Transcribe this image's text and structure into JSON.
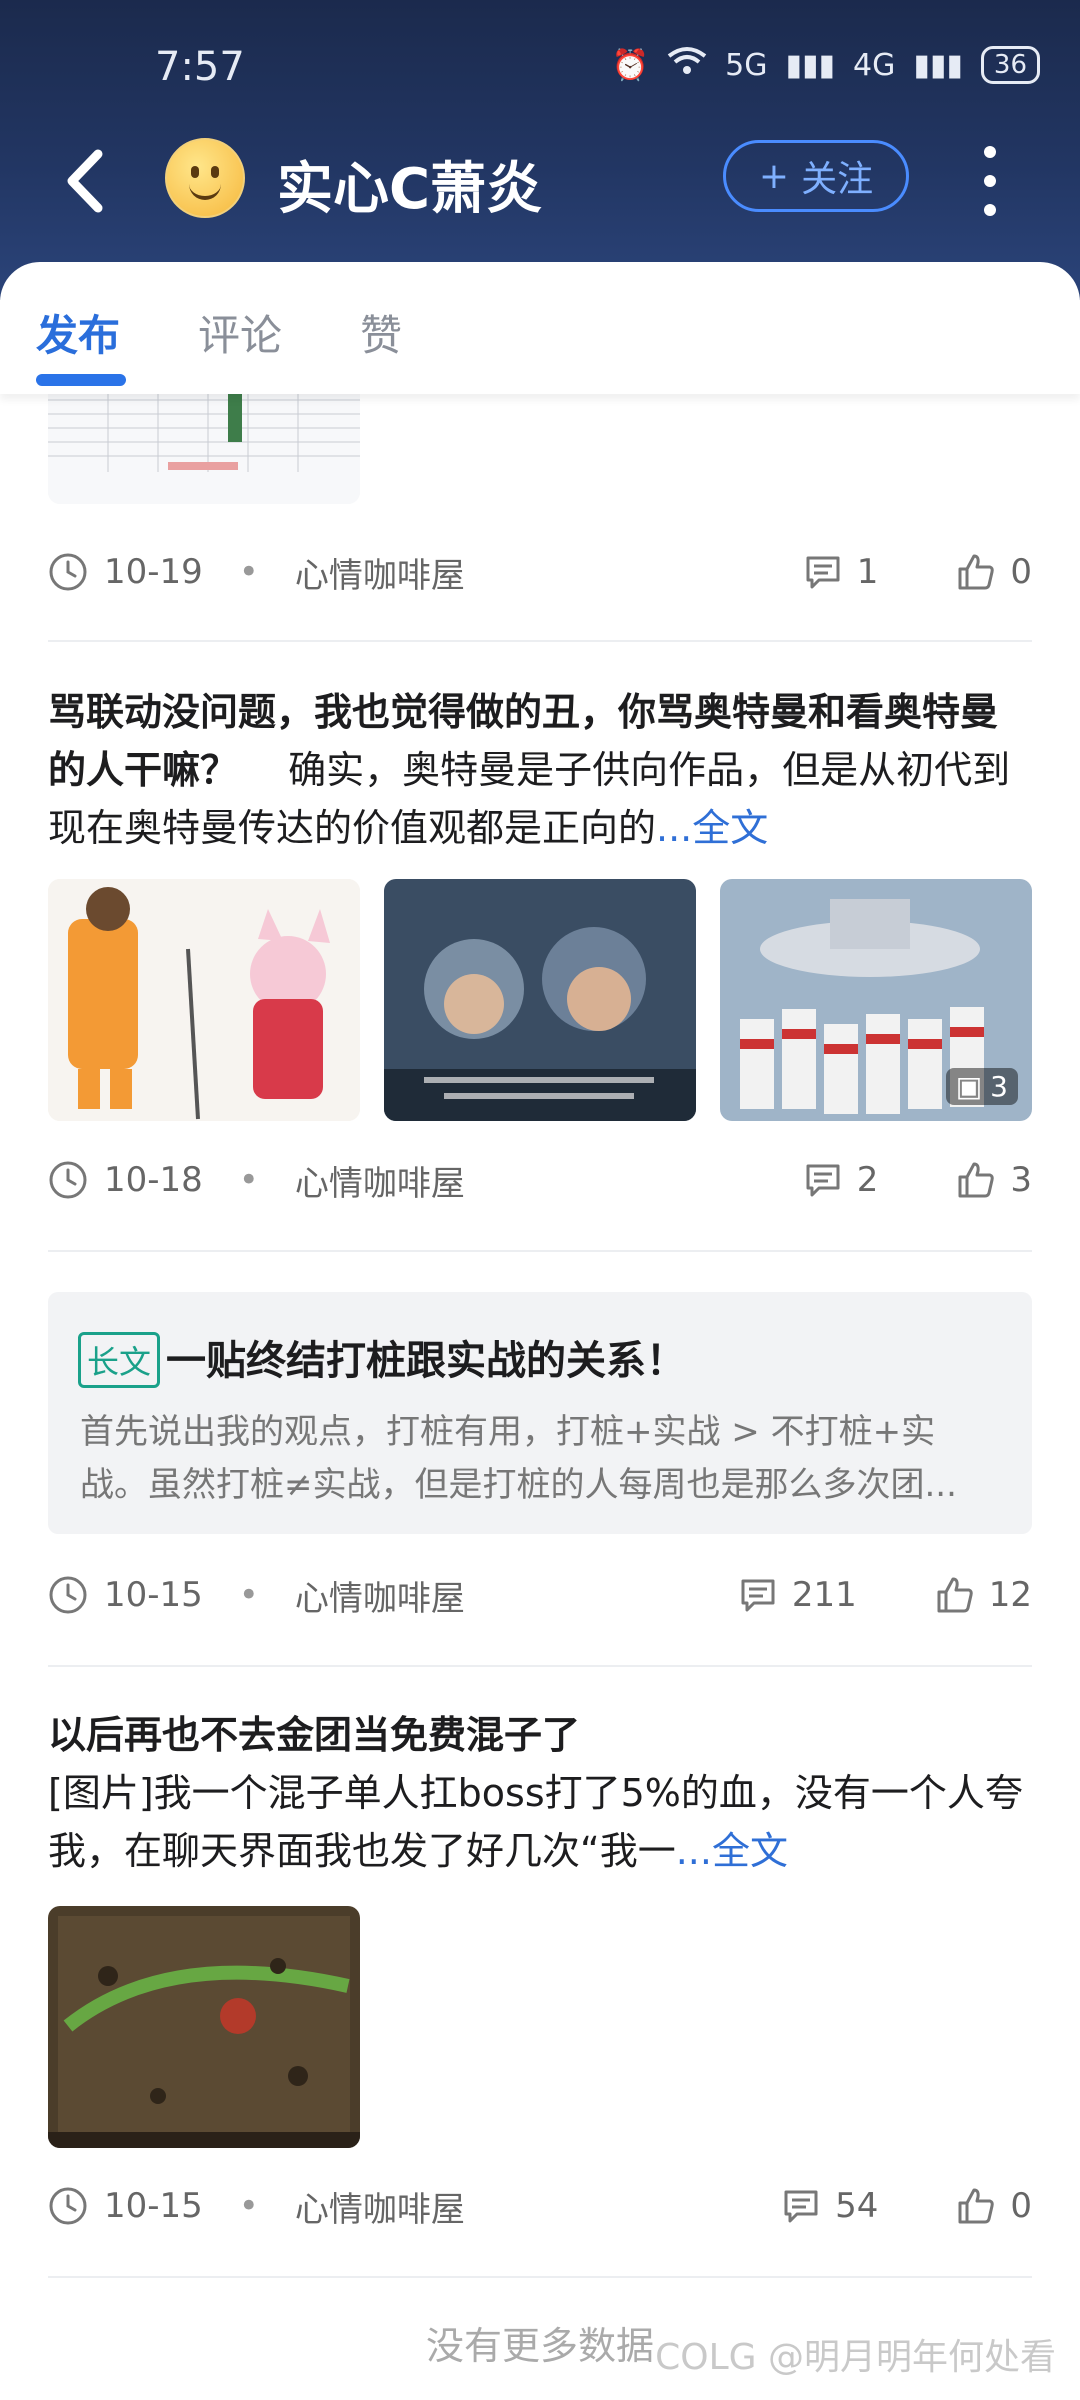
{
  "status": {
    "time": "7:57",
    "signal1": "5G",
    "signal2": "4G",
    "battery": "36"
  },
  "header": {
    "user_name": "实心C萧炎",
    "follow_label": "关注"
  },
  "tabs": [
    {
      "label": "发布"
    },
    {
      "label": "评论"
    },
    {
      "label": "赞"
    }
  ],
  "posts": [
    {
      "date": "10-19",
      "circle": "心情咖啡屋",
      "comments": "1",
      "likes": "0"
    },
    {
      "title": "骂联动没问题，我也觉得做的丑，你骂奥特曼和看奥特曼的人干嘛？",
      "body": "确实，奥特曼是子供向作品，但是从初代到现在奥特曼传达的价值观都是正向的",
      "more": "...全文",
      "image_count": "3",
      "date": "10-18",
      "circle": "心情咖啡屋",
      "comments": "2",
      "likes": "3"
    },
    {
      "tag": "长文",
      "title": "一贴终结打桩跟实战的关系！",
      "body": "首先说出我的观点，打桩有用，打桩+实战 > 不打桩+实战。虽然打桩≠实战，但是打桩的人每周也是那么多次团...",
      "date": "10-15",
      "circle": "心情咖啡屋",
      "comments": "211",
      "likes": "12"
    },
    {
      "title": "以后再也不去金团当免费混子了",
      "body": "[图片]我一个混子单人扛boss打了5%的血，没有一个人夸我，在聊天界面我也发了好几次“我一",
      "more": "...全文",
      "date": "10-15",
      "circle": "心情咖啡屋",
      "comments": "54",
      "likes": "0"
    }
  ],
  "footer": {
    "no_more": "没有更多数据",
    "watermark": "COLG @明月明年何处看"
  }
}
